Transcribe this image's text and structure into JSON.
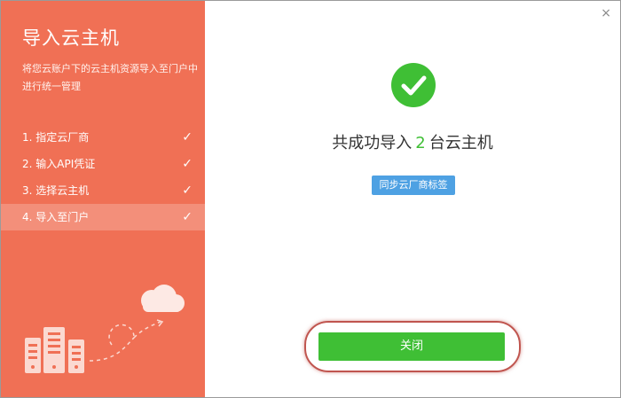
{
  "sidebar": {
    "title": "导入云主机",
    "description": "将您云账户下的云主机资源导入至门户中进行统一管理",
    "steps": [
      {
        "label": "1. 指定云厂商",
        "done": true
      },
      {
        "label": "2. 输入API凭证",
        "done": true
      },
      {
        "label": "3. 选择云主机",
        "done": true
      },
      {
        "label": "4. 导入至门户",
        "done": true,
        "active": true
      }
    ],
    "check_glyph": "✓"
  },
  "main": {
    "close_glyph": "×",
    "success_icon": "check-circle-icon",
    "headline_prefix": "共成功导入",
    "headline_count": "2",
    "headline_suffix": "台云主机",
    "sync_button": "同步云厂商标签",
    "close_button": "关闭"
  },
  "colors": {
    "sidebar_bg": "#f07055",
    "success_green": "#3fbf35",
    "sync_blue": "#4ea1e3",
    "highlight_red": "#c0554f"
  }
}
